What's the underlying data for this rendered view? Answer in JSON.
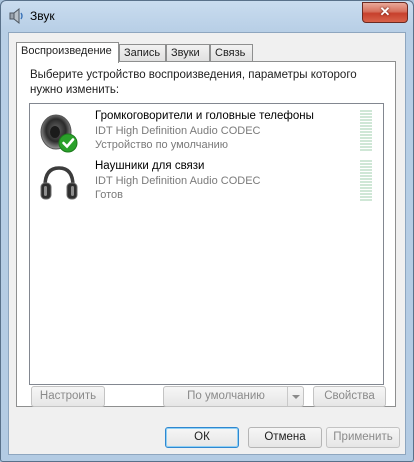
{
  "window": {
    "title": "Звук",
    "close_label": "✕"
  },
  "tabs": [
    {
      "label": "Воспроизведение",
      "active": true
    },
    {
      "label": "Запись",
      "active": false
    },
    {
      "label": "Звуки",
      "active": false
    },
    {
      "label": "Связь",
      "active": false
    }
  ],
  "panel": {
    "instruction": "Выберите устройство воспроизведения, параметры которого нужно изменить:"
  },
  "devices": [
    {
      "name": "Громкоговорители и головные телефоны",
      "driver": "IDT High Definition Audio CODEC",
      "status": "Устройство по умолчанию",
      "icon": "speaker-icon",
      "default_badge": "check-icon"
    },
    {
      "name": "Наушники для связи",
      "driver": "IDT High Definition Audio CODEC",
      "status": "Готов",
      "icon": "headphones-icon"
    }
  ],
  "actions": {
    "configure": "Настроить",
    "set_default": "По умолчанию",
    "properties": "Свойства"
  },
  "footer": {
    "ok": "ОК",
    "cancel": "Отмена",
    "apply": "Применить"
  },
  "colors": {
    "accent": "#2f87d0",
    "level_meter": "#cfe7d6",
    "badge": "#2aa12a"
  }
}
